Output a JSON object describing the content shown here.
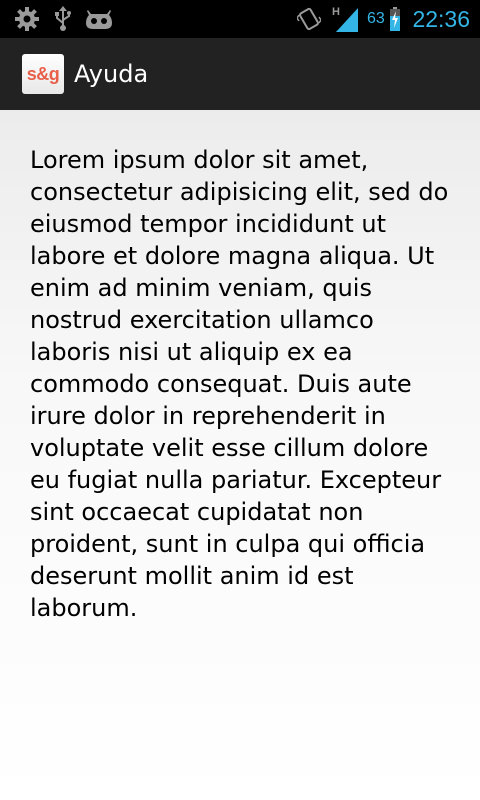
{
  "status_bar": {
    "icons": [
      "settings-icon",
      "usb-icon",
      "android-debug-icon",
      "vibrate-icon",
      "signal-icon",
      "battery-charging-icon"
    ],
    "network_type": "H",
    "battery_percent": "63",
    "time": "22:36",
    "accent_color": "#33b5e5"
  },
  "action_bar": {
    "app_icon_text": "s&g",
    "title": "Ayuda"
  },
  "content": {
    "body": "Lorem ipsum dolor sit amet, consectetur adipisicing elit, sed do eiusmod tempor incididunt ut labore et dolore magna aliqua. Ut enim ad minim veniam, quis nostrud exercitation ullamco laboris nisi ut aliquip ex ea commodo consequat. Duis aute irure dolor in reprehenderit in voluptate velit esse cillum dolore eu fugiat nulla pariatur. Excepteur sint occaecat cupidatat non proident, sunt in culpa qui officia deserunt mollit anim id est laborum."
  }
}
